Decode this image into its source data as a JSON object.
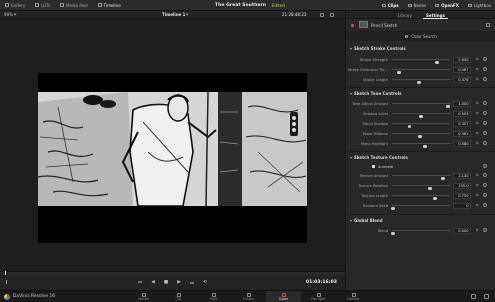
{
  "topbar": {
    "left": [
      {
        "label": "Gallery",
        "icon": "gallery-icon"
      },
      {
        "label": "LUTs",
        "icon": "luts-icon"
      },
      {
        "label": "Media Pool",
        "icon": "media-pool-icon"
      },
      {
        "label": "Timeline",
        "icon": "timeline-icon"
      }
    ],
    "project_title": "The Great Southern",
    "status": "Edited",
    "right": [
      {
        "label": "Clips",
        "icon": "clips-icon"
      },
      {
        "label": "Nodes",
        "icon": "nodes-icon"
      },
      {
        "label": "OpenFX",
        "icon": "openfx-icon"
      },
      {
        "label": "Lightbox",
        "icon": "lightbox-icon"
      }
    ]
  },
  "viewer": {
    "zoom": "99%",
    "timeline_name": "Timeline 1",
    "timecode": "21:28:48:23"
  },
  "transport": {
    "timecode": "01:03:16:03",
    "buttons": [
      "⏮",
      "◀",
      "■",
      "▶",
      "⏭",
      "⟲"
    ]
  },
  "pagebar": {
    "app_name": "DaVinci Resolve 16",
    "pages": [
      "Media",
      "Cut",
      "Edit",
      "Fusion",
      "Color",
      "Fairlight",
      "Deliver"
    ]
  },
  "inspector": {
    "tabs": [
      "Library",
      "Settings"
    ],
    "effect_name": "Pencil Sketch",
    "color_search_label": "Color Search",
    "sections": {
      "stroke": {
        "title": "Sketch Stroke Controls",
        "params": [
          {
            "label": "Stroke Strength",
            "value": "2.640",
            "pos": 0.78
          },
          {
            "label": "Stroke Extension Thr...",
            "value": "0.067",
            "pos": 0.12
          },
          {
            "label": "Stroke Length",
            "value": "0.476",
            "pos": 0.47
          }
        ]
      },
      "tone": {
        "title": "Sketch Tone Controls",
        "params": [
          {
            "label": "Tone Adjust Amount",
            "value": "1.000",
            "pos": 0.97
          },
          {
            "label": "Shadow Level",
            "value": "0.503",
            "pos": 0.5
          },
          {
            "label": "Mono Shadow",
            "value": "0.307",
            "pos": 0.3
          },
          {
            "label": "Mono Midtone",
            "value": "0.481",
            "pos": 0.48
          },
          {
            "label": "Mono Highlight",
            "value": "0.580",
            "pos": 0.57
          }
        ]
      },
      "texture": {
        "title": "Sketch Texture Controls",
        "animate_label": "Animate",
        "params": [
          {
            "label": "Texture Amount",
            "value": "2.130",
            "pos": 0.88
          },
          {
            "label": "Texture Rotation",
            "value": "135.0",
            "pos": 0.66
          },
          {
            "label": "Texture Length",
            "value": "0.750",
            "pos": 0.74
          },
          {
            "label": "Random Seed",
            "value": "0",
            "pos": 0.02
          }
        ]
      },
      "blend": {
        "title": "Global Blend",
        "params": [
          {
            "label": "Blend",
            "value": "0.000",
            "pos": 0.02
          }
        ]
      }
    }
  }
}
